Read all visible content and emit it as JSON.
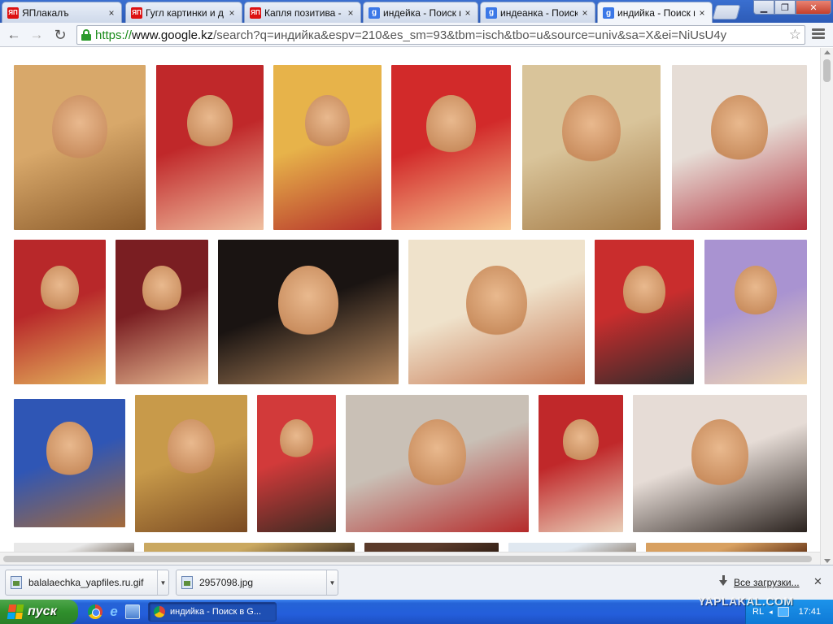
{
  "tabs": [
    {
      "icon": "yaplakal-icon",
      "icon_text": "ЯП",
      "label": "ЯПлакалъ"
    },
    {
      "icon": "yaplakal-icon",
      "icon_text": "ЯП",
      "label": "Гугл картинки и д"
    },
    {
      "icon": "yaplakal-icon",
      "icon_text": "ЯП",
      "label": "Капля позитива -"
    },
    {
      "icon": "google-icon",
      "icon_text": "g",
      "label": "индейка - Поиск в"
    },
    {
      "icon": "google-icon",
      "icon_text": "g",
      "label": "индеанка - Поиск"
    },
    {
      "icon": "google-icon",
      "icon_text": "g",
      "label": "индийка - Поиск в",
      "active": true
    }
  ],
  "address_bar": {
    "scheme": "https://",
    "host": "www.google.kz",
    "path": "/search?q=индийка&espv=210&es_sm=93&tbm=isch&tbo=u&source=univ&sa=X&ei=NiUsU4y"
  },
  "image_grid": {
    "images": [
      {
        "name": "bride-portrait-1",
        "colors": [
          "#d8a86a",
          "#8a5a2a"
        ]
      },
      {
        "name": "bride-portrait-2",
        "colors": [
          "#c0282a",
          "#f0c0a0"
        ]
      },
      {
        "name": "bride-portrait-3",
        "colors": [
          "#e7b34a",
          "#b5302a"
        ]
      },
      {
        "name": "bride-portrait-4",
        "colors": [
          "#d22a2a",
          "#f7c690"
        ]
      },
      {
        "name": "bride-portrait-5",
        "colors": [
          "#d9c49a",
          "#a47a45"
        ]
      },
      {
        "name": "bride-portrait-6",
        "colors": [
          "#e6ddd6",
          "#b3303c"
        ]
      },
      {
        "name": "bride-portrait-7",
        "colors": [
          "#b8282a",
          "#e3b45c"
        ]
      },
      {
        "name": "bride-portrait-8",
        "colors": [
          "#7a1e22",
          "#e6b890"
        ]
      },
      {
        "name": "actress-portrait-1",
        "colors": [
          "#1a1412",
          "#b98b60"
        ]
      },
      {
        "name": "dancer-portrait",
        "colors": [
          "#efe2cb",
          "#c4704a"
        ]
      },
      {
        "name": "bride-portrait-9",
        "colors": [
          "#c92d2d",
          "#2b2b2b"
        ]
      },
      {
        "name": "painted-portrait",
        "colors": [
          "#a993d1",
          "#f1d8b4"
        ]
      },
      {
        "name": "smiling-woman",
        "colors": [
          "#2f56b5",
          "#a46a3a"
        ]
      },
      {
        "name": "jewelry-portrait",
        "colors": [
          "#c89a4a",
          "#7a4a22"
        ]
      },
      {
        "name": "bride-portrait-10",
        "colors": [
          "#d23a3a",
          "#3b2a22"
        ]
      },
      {
        "name": "two-women-photo",
        "colors": [
          "#c9c0b6",
          "#b52a2a"
        ]
      },
      {
        "name": "bride-portrait-11",
        "colors": [
          "#c0282a",
          "#e9cfb8"
        ]
      },
      {
        "name": "actress-portrait-2",
        "colors": [
          "#e6dcd6",
          "#2a221e"
        ]
      },
      {
        "name": "partial-1",
        "colors": [
          "#e8e8e8",
          "#6a5a4a"
        ]
      },
      {
        "name": "partial-2",
        "colors": [
          "#caa860",
          "#3a2a1a"
        ]
      },
      {
        "name": "partial-3",
        "colors": [
          "#5a3a2a",
          "#2a1a10"
        ]
      },
      {
        "name": "partial-4",
        "colors": [
          "#e0e8f0",
          "#8a7a6a"
        ]
      },
      {
        "name": "partial-5",
        "colors": [
          "#d8a060",
          "#5a2a10"
        ]
      }
    ]
  },
  "downloads": {
    "items": [
      {
        "filename": "balalaechka_yapfiles.ru.gif"
      },
      {
        "filename": "2957098.jpg"
      }
    ],
    "show_all_label": "Все загрузки...",
    "close_label": "✕"
  },
  "taskbar": {
    "start_label": "пуск",
    "task_label": "индийка - Поиск в G...",
    "language": "RL",
    "clock": "17:41"
  },
  "watermark": "YAPLAKAL.COM"
}
